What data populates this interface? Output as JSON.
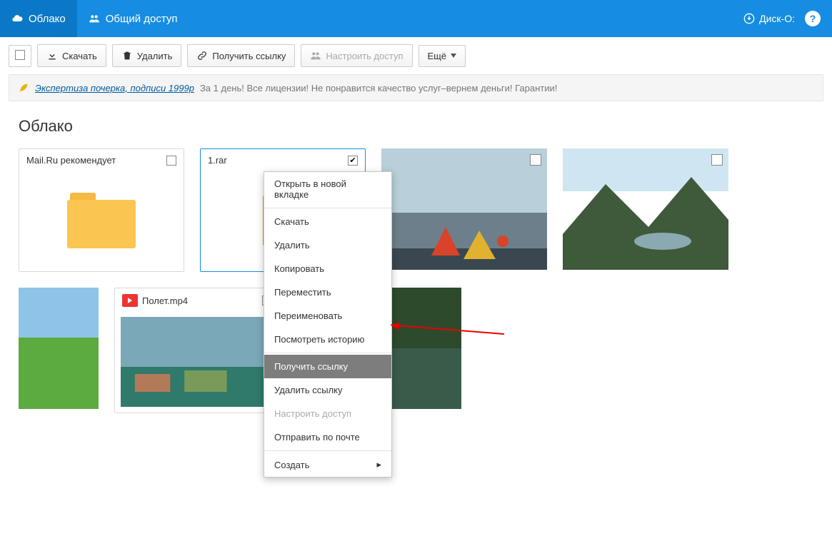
{
  "topbar": {
    "tab_cloud": "Облако",
    "tab_shared": "Общий доступ",
    "disk_o": "Диск-О:",
    "help": "?"
  },
  "toolbar": {
    "download": "Скачать",
    "delete": "Удалить",
    "get_link": "Получить ссылку",
    "access": "Настроить доступ",
    "more": "Ещё"
  },
  "ad": {
    "link": "Экспертиза почерка, подписи 1999р",
    "text": "За 1 день! Все лицензии! Не понравится качество услуг–вернем деньги! Гарантии!"
  },
  "page_title": "Облако",
  "tiles": {
    "recommend": "Mail.Ru рекомендует",
    "rar": "1.rar",
    "video": "Полет.mp4"
  },
  "context_menu": {
    "open_tab": "Открыть в новой вкладке",
    "download": "Скачать",
    "delete": "Удалить",
    "copy": "Копировать",
    "move": "Переместить",
    "rename": "Переименовать",
    "history": "Посмотреть историю",
    "get_link": "Получить ссылку",
    "remove_link": "Удалить ссылку",
    "access": "Настроить доступ",
    "send_mail": "Отправить по почте",
    "create": "Создать"
  }
}
